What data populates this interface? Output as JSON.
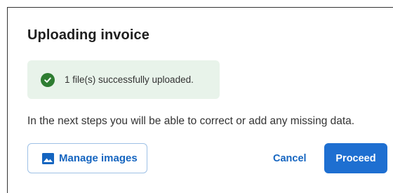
{
  "dialog": {
    "title": "Uploading invoice",
    "success_message": "1 file(s) successfully uploaded.",
    "info_text": "In the next steps you will be able to correct or add any missing data.",
    "manage_images_label": "Manage images",
    "cancel_label": "Cancel",
    "proceed_label": "Proceed"
  },
  "icons": {
    "success": "check-circle-icon",
    "manage_images": "image-icon"
  },
  "colors": {
    "success_bg": "#e8f3ea",
    "success_icon": "#2e7d32",
    "accent": "#1565c0",
    "primary_button": "#1e6fd1"
  }
}
